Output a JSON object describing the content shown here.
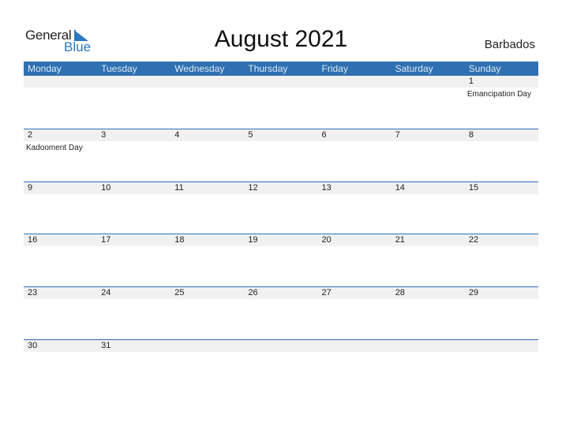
{
  "logo": {
    "line1": "General",
    "line2": "Blue"
  },
  "title": "August 2021",
  "country": "Barbados",
  "colors": {
    "accent": "#2e70b1",
    "strip": "#f1f1f1"
  },
  "weekdays": [
    "Monday",
    "Tuesday",
    "Wednesday",
    "Thursday",
    "Friday",
    "Saturday",
    "Sunday"
  ],
  "weeks": [
    [
      {
        "day": "",
        "holiday": ""
      },
      {
        "day": "",
        "holiday": ""
      },
      {
        "day": "",
        "holiday": ""
      },
      {
        "day": "",
        "holiday": ""
      },
      {
        "day": "",
        "holiday": ""
      },
      {
        "day": "",
        "holiday": ""
      },
      {
        "day": "1",
        "holiday": "Emancipation Day"
      }
    ],
    [
      {
        "day": "2",
        "holiday": "Kadooment Day"
      },
      {
        "day": "3",
        "holiday": ""
      },
      {
        "day": "4",
        "holiday": ""
      },
      {
        "day": "5",
        "holiday": ""
      },
      {
        "day": "6",
        "holiday": ""
      },
      {
        "day": "7",
        "holiday": ""
      },
      {
        "day": "8",
        "holiday": ""
      }
    ],
    [
      {
        "day": "9",
        "holiday": ""
      },
      {
        "day": "10",
        "holiday": ""
      },
      {
        "day": "11",
        "holiday": ""
      },
      {
        "day": "12",
        "holiday": ""
      },
      {
        "day": "13",
        "holiday": ""
      },
      {
        "day": "14",
        "holiday": ""
      },
      {
        "day": "15",
        "holiday": ""
      }
    ],
    [
      {
        "day": "16",
        "holiday": ""
      },
      {
        "day": "17",
        "holiday": ""
      },
      {
        "day": "18",
        "holiday": ""
      },
      {
        "day": "19",
        "holiday": ""
      },
      {
        "day": "20",
        "holiday": ""
      },
      {
        "day": "21",
        "holiday": ""
      },
      {
        "day": "22",
        "holiday": ""
      }
    ],
    [
      {
        "day": "23",
        "holiday": ""
      },
      {
        "day": "24",
        "holiday": ""
      },
      {
        "day": "25",
        "holiday": ""
      },
      {
        "day": "26",
        "holiday": ""
      },
      {
        "day": "27",
        "holiday": ""
      },
      {
        "day": "28",
        "holiday": ""
      },
      {
        "day": "29",
        "holiday": ""
      }
    ],
    [
      {
        "day": "30",
        "holiday": ""
      },
      {
        "day": "31",
        "holiday": ""
      },
      {
        "day": "",
        "holiday": ""
      },
      {
        "day": "",
        "holiday": ""
      },
      {
        "day": "",
        "holiday": ""
      },
      {
        "day": "",
        "holiday": ""
      },
      {
        "day": "",
        "holiday": ""
      }
    ]
  ]
}
